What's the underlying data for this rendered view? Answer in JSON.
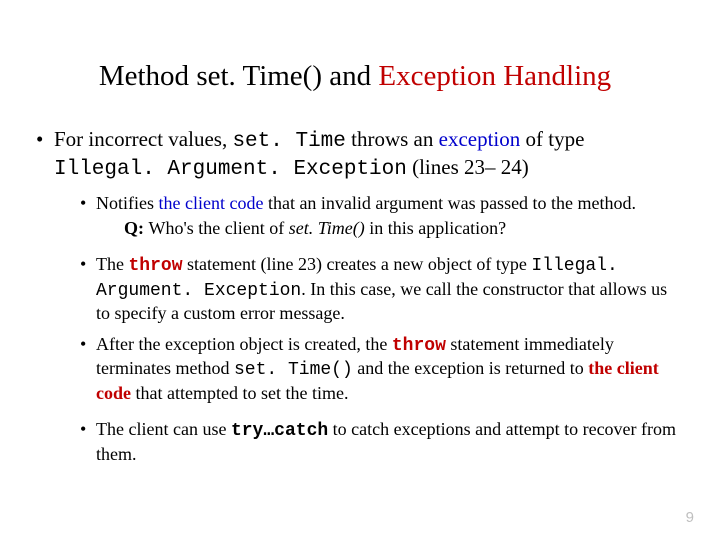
{
  "title": {
    "t1": "Method ",
    "t2": "set. Time()",
    "t3": " and ",
    "t4": "Exception Handling"
  },
  "b1": {
    "a": "For incorrect values, ",
    "b": "set. Time",
    "c": " throws an ",
    "d": "exception",
    "e": " of type ",
    "f": "Illegal. Argument. Exception",
    "g": " (lines 23– 24)"
  },
  "s1": {
    "a": "Notifies ",
    "b": "the client code",
    "c": " that an invalid argument was passed to the method."
  },
  "q": {
    "a": "Q: ",
    "b": "Who's the client of ",
    "c": "set. Time()",
    "d": " in this application?"
  },
  "s2": {
    "a": "The ",
    "b": "throw",
    "c": " statement (line 23) creates a new object of type ",
    "d": "Illegal. Argument. Exception",
    "e": ". In this case, we call the constructor that allows us to specify a custom error message."
  },
  "s3": {
    "a": "After the exception object is created, the ",
    "b": "throw",
    "c": "  statement immediately terminates method ",
    "d": "set. Time()",
    "e": " and the exception is returned to ",
    "f": "the client code",
    "g": " that attempted to set the time."
  },
  "s4": {
    "a": "The client can use ",
    "b": "try…catch",
    "c": " to catch exceptions and attempt to recover from them."
  },
  "pageNumber": "9"
}
